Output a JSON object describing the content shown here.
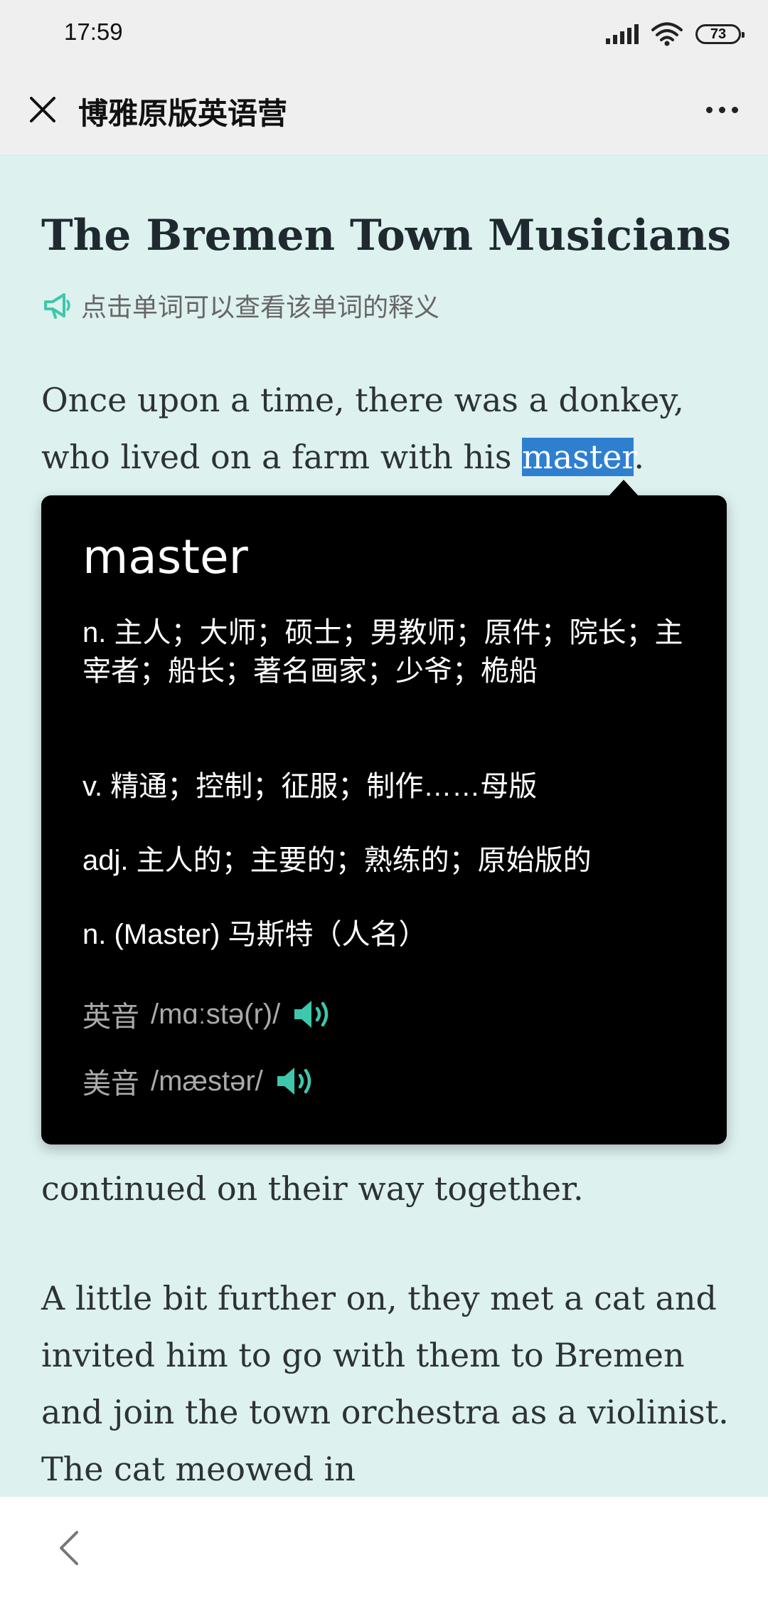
{
  "status": {
    "time": "17:59",
    "battery": "73"
  },
  "header": {
    "title": "博雅原版英语营"
  },
  "article": {
    "title": "The Bremen Town Musicians",
    "hint": "点击单词可以查看该单词的释义",
    "para1_before": "Once upon a time, there was a donkey, who lived on a farm with his ",
    "para1_highlight": "master",
    "para1_after": ".",
    "para2_partial": "continued on their way together.",
    "para3": "A little bit further on, they met a cat and invited him to go with them to Bremen and join the town orchestra as a violinist. The cat meowed in"
  },
  "popup": {
    "word": "master",
    "definitions": [
      "n. 主人；大师；硕士；男教师；原件；院长；主宰者；船长；著名画家；少爷；桅船",
      "v. 精通；控制；征服；制作……母版",
      "adj. 主人的；主要的；熟练的；原始版的",
      "n. (Master) 马斯特（人名）"
    ],
    "uk_label": "英音",
    "uk_phonetic": "/mɑːstə(r)/",
    "us_label": "美音",
    "us_phonetic": "/mæstər/"
  },
  "colors": {
    "accent": "#3fc7ac",
    "highlight": "#2f7fd1",
    "background": "#ddf1ee"
  }
}
